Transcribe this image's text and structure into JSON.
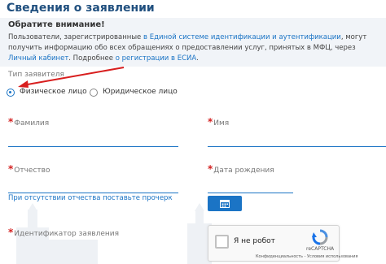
{
  "header": {
    "title": "Сведения о заявлении"
  },
  "notice": {
    "title": "Обратите внимание!",
    "text_part1": "Пользователи, зарегистрированные ",
    "link_esia": "в Единой системе идентификации и аутентификации",
    "text_part2": ", могут получить информацию обо всех обращениях о предоставлении услуг, принятых в МФЦ, через ",
    "link_cabinet": "Личный кабинет",
    "text_part3": ". Подробнее ",
    "link_register": "о регистрации в ЕСИА",
    "text_part4": "."
  },
  "applicant_type": {
    "label": "Тип заявителя",
    "options": [
      {
        "label": "Физическое лицо",
        "selected": true
      },
      {
        "label": "Юридическое лицо",
        "selected": false
      }
    ]
  },
  "fields": {
    "required_mark": "*",
    "surname": "Фамилия",
    "name": "Имя",
    "patronymic": "Отчество",
    "birth_date": "Дата рождения",
    "application_id": "Идентификатор заявления",
    "no_patronymic_hint": "При отсутствии отчества поставьте прочерк"
  },
  "captcha": {
    "label": "Я не робот",
    "brand": "reCAPTCHA",
    "links": "Конфиденциальность - Условия использования"
  },
  "colors": {
    "accent": "#1b74c5",
    "title": "#21507f",
    "required": "#d32020",
    "arrow": "#d81e1e"
  }
}
